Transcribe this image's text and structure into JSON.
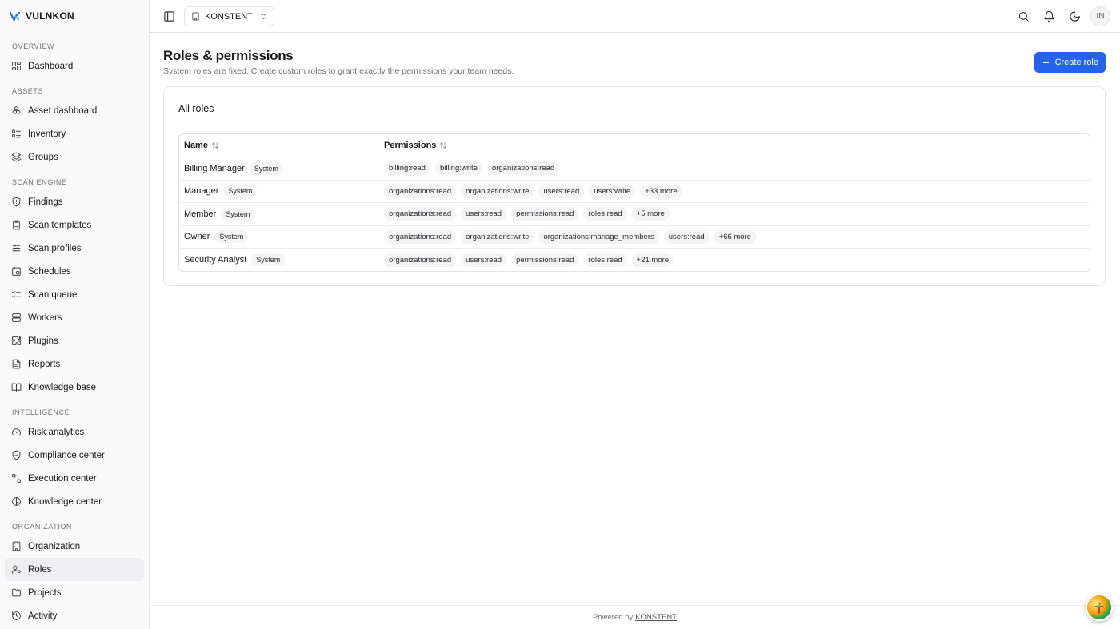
{
  "brand": {
    "name": "VULNKON",
    "logo_icon": "vulnkon-logo-icon"
  },
  "sidebar": {
    "sections": [
      {
        "label": "OVERVIEW",
        "items": [
          {
            "label": "Dashboard",
            "icon": "dashboard-grid-icon"
          }
        ]
      },
      {
        "label": "ASSETS",
        "items": [
          {
            "label": "Asset dashboard",
            "icon": "boxes-icon"
          },
          {
            "label": "Inventory",
            "icon": "list-icon"
          },
          {
            "label": "Groups",
            "icon": "layers-icon"
          }
        ]
      },
      {
        "label": "SCAN ENGINE",
        "items": [
          {
            "label": "Findings",
            "icon": "shield-alert-icon"
          },
          {
            "label": "Scan templates",
            "icon": "clipboard-icon"
          },
          {
            "label": "Scan profiles",
            "icon": "sliders-icon"
          },
          {
            "label": "Schedules",
            "icon": "calendar-clock-icon"
          },
          {
            "label": "Scan queue",
            "icon": "list-checks-icon"
          },
          {
            "label": "Workers",
            "icon": "server-icon"
          },
          {
            "label": "Plugins",
            "icon": "puzzle-icon"
          },
          {
            "label": "Reports",
            "icon": "file-text-icon"
          },
          {
            "label": "Knowledge base",
            "icon": "book-open-icon"
          }
        ]
      },
      {
        "label": "INTELLIGENCE",
        "items": [
          {
            "label": "Risk analytics",
            "icon": "gauge-icon"
          },
          {
            "label": "Compliance center",
            "icon": "shield-check-icon"
          },
          {
            "label": "Execution center",
            "icon": "workflow-icon"
          },
          {
            "label": "Knowledge center",
            "icon": "brain-icon"
          }
        ]
      },
      {
        "label": "ORGANIZATION",
        "items": [
          {
            "label": "Organization",
            "icon": "building-icon"
          },
          {
            "label": "Roles",
            "icon": "user-cog-icon",
            "active": true
          },
          {
            "label": "Projects",
            "icon": "folder-icon"
          },
          {
            "label": "Activity",
            "icon": "history-icon"
          }
        ]
      }
    ]
  },
  "topbar": {
    "org_name": "KONSTENT",
    "avatar_initials": "IN"
  },
  "page": {
    "title": "Roles & permissions",
    "subtitle": "System roles are fixed. Create custom roles to grant exactly the permissions your team needs.",
    "create_button": "Create role"
  },
  "card": {
    "title": "All roles",
    "columns": {
      "name": "Name",
      "permissions": "Permissions"
    },
    "rows": [
      {
        "name": "Billing Manager",
        "badge": "System",
        "permissions": [
          "billing:read",
          "billing:write",
          "organizations:read"
        ],
        "more": ""
      },
      {
        "name": "Manager",
        "badge": "System",
        "permissions": [
          "organizations:read",
          "organizations:write",
          "users:read",
          "users:write"
        ],
        "more": "+33 more"
      },
      {
        "name": "Member",
        "badge": "System",
        "permissions": [
          "organizations:read",
          "users:read",
          "permissions:read",
          "roles:read"
        ],
        "more": "+5 more"
      },
      {
        "name": "Owner",
        "badge": "System",
        "permissions": [
          "organizations:read",
          "organizations:write",
          "organizations:manage_members",
          "users:read"
        ],
        "more": "+66 more"
      },
      {
        "name": "Security Analyst",
        "badge": "System",
        "permissions": [
          "organizations:read",
          "users:read",
          "permissions:read",
          "roles:read"
        ],
        "more": "+21 more"
      }
    ]
  },
  "footer": {
    "prefix": "Powered by",
    "link": "KONSTENT"
  },
  "colors": {
    "accent": "#2563eb",
    "sidebar_bg": "#fafafa",
    "border": "#e4e4e7"
  }
}
